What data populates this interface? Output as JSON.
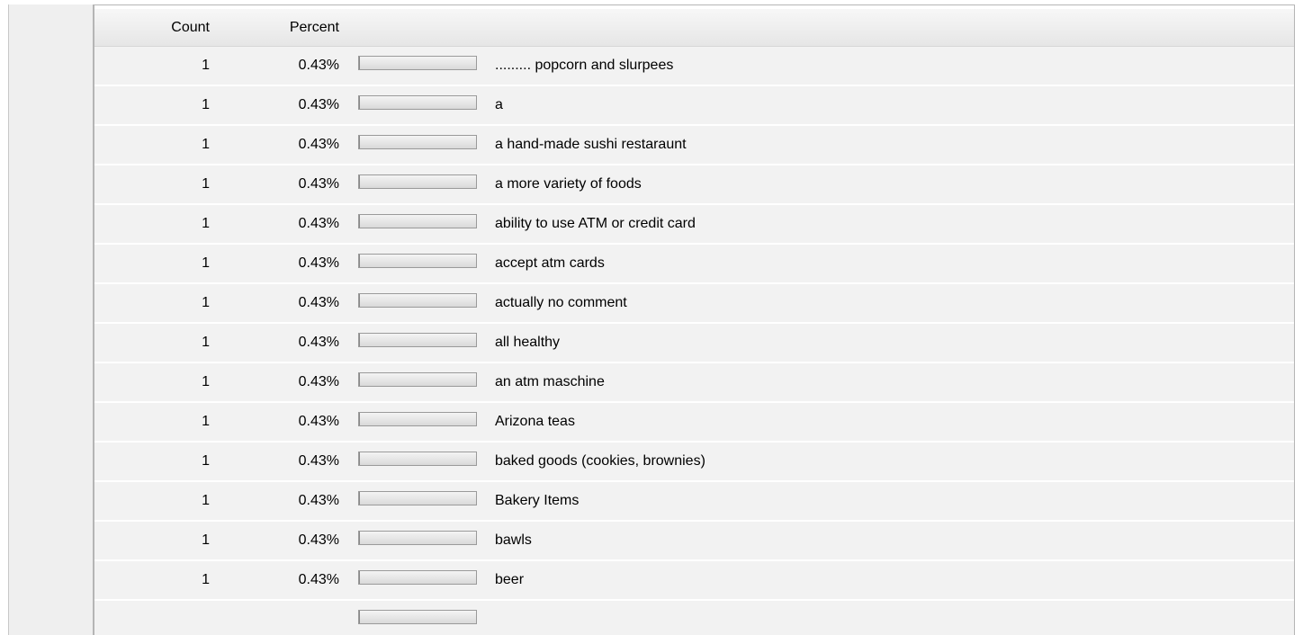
{
  "table": {
    "header": {
      "count": "Count",
      "percent": "Percent"
    },
    "rows": [
      {
        "count": "1",
        "percent": "0.43%",
        "bar_fraction": 0.0043,
        "label": "......... popcorn and slurpees"
      },
      {
        "count": "1",
        "percent": "0.43%",
        "bar_fraction": 0.0043,
        "label": "a"
      },
      {
        "count": "1",
        "percent": "0.43%",
        "bar_fraction": 0.0043,
        "label": "a hand-made sushi restaraunt"
      },
      {
        "count": "1",
        "percent": "0.43%",
        "bar_fraction": 0.0043,
        "label": "a more variety of foods"
      },
      {
        "count": "1",
        "percent": "0.43%",
        "bar_fraction": 0.0043,
        "label": "ability to use ATM or credit card"
      },
      {
        "count": "1",
        "percent": "0.43%",
        "bar_fraction": 0.0043,
        "label": "accept atm cards"
      },
      {
        "count": "1",
        "percent": "0.43%",
        "bar_fraction": 0.0043,
        "label": "actually no comment"
      },
      {
        "count": "1",
        "percent": "0.43%",
        "bar_fraction": 0.0043,
        "label": "all healthy"
      },
      {
        "count": "1",
        "percent": "0.43%",
        "bar_fraction": 0.0043,
        "label": "an atm maschine"
      },
      {
        "count": "1",
        "percent": "0.43%",
        "bar_fraction": 0.0043,
        "label": "Arizona teas"
      },
      {
        "count": "1",
        "percent": "0.43%",
        "bar_fraction": 0.0043,
        "label": "baked goods (cookies, brownies)"
      },
      {
        "count": "1",
        "percent": "0.43%",
        "bar_fraction": 0.0043,
        "label": "Bakery Items"
      },
      {
        "count": "1",
        "percent": "0.43%",
        "bar_fraction": 0.0043,
        "label": "bawls"
      },
      {
        "count": "1",
        "percent": "0.43%",
        "bar_fraction": 0.0043,
        "label": "beer"
      }
    ],
    "partial_row": {
      "count": "",
      "percent": "",
      "bar_fraction": 0.0043,
      "label": ""
    }
  },
  "colors": {
    "row_background": "#f2f2f2",
    "bar_border": "#9a9a9a",
    "header_background": "#e6e6e6"
  }
}
